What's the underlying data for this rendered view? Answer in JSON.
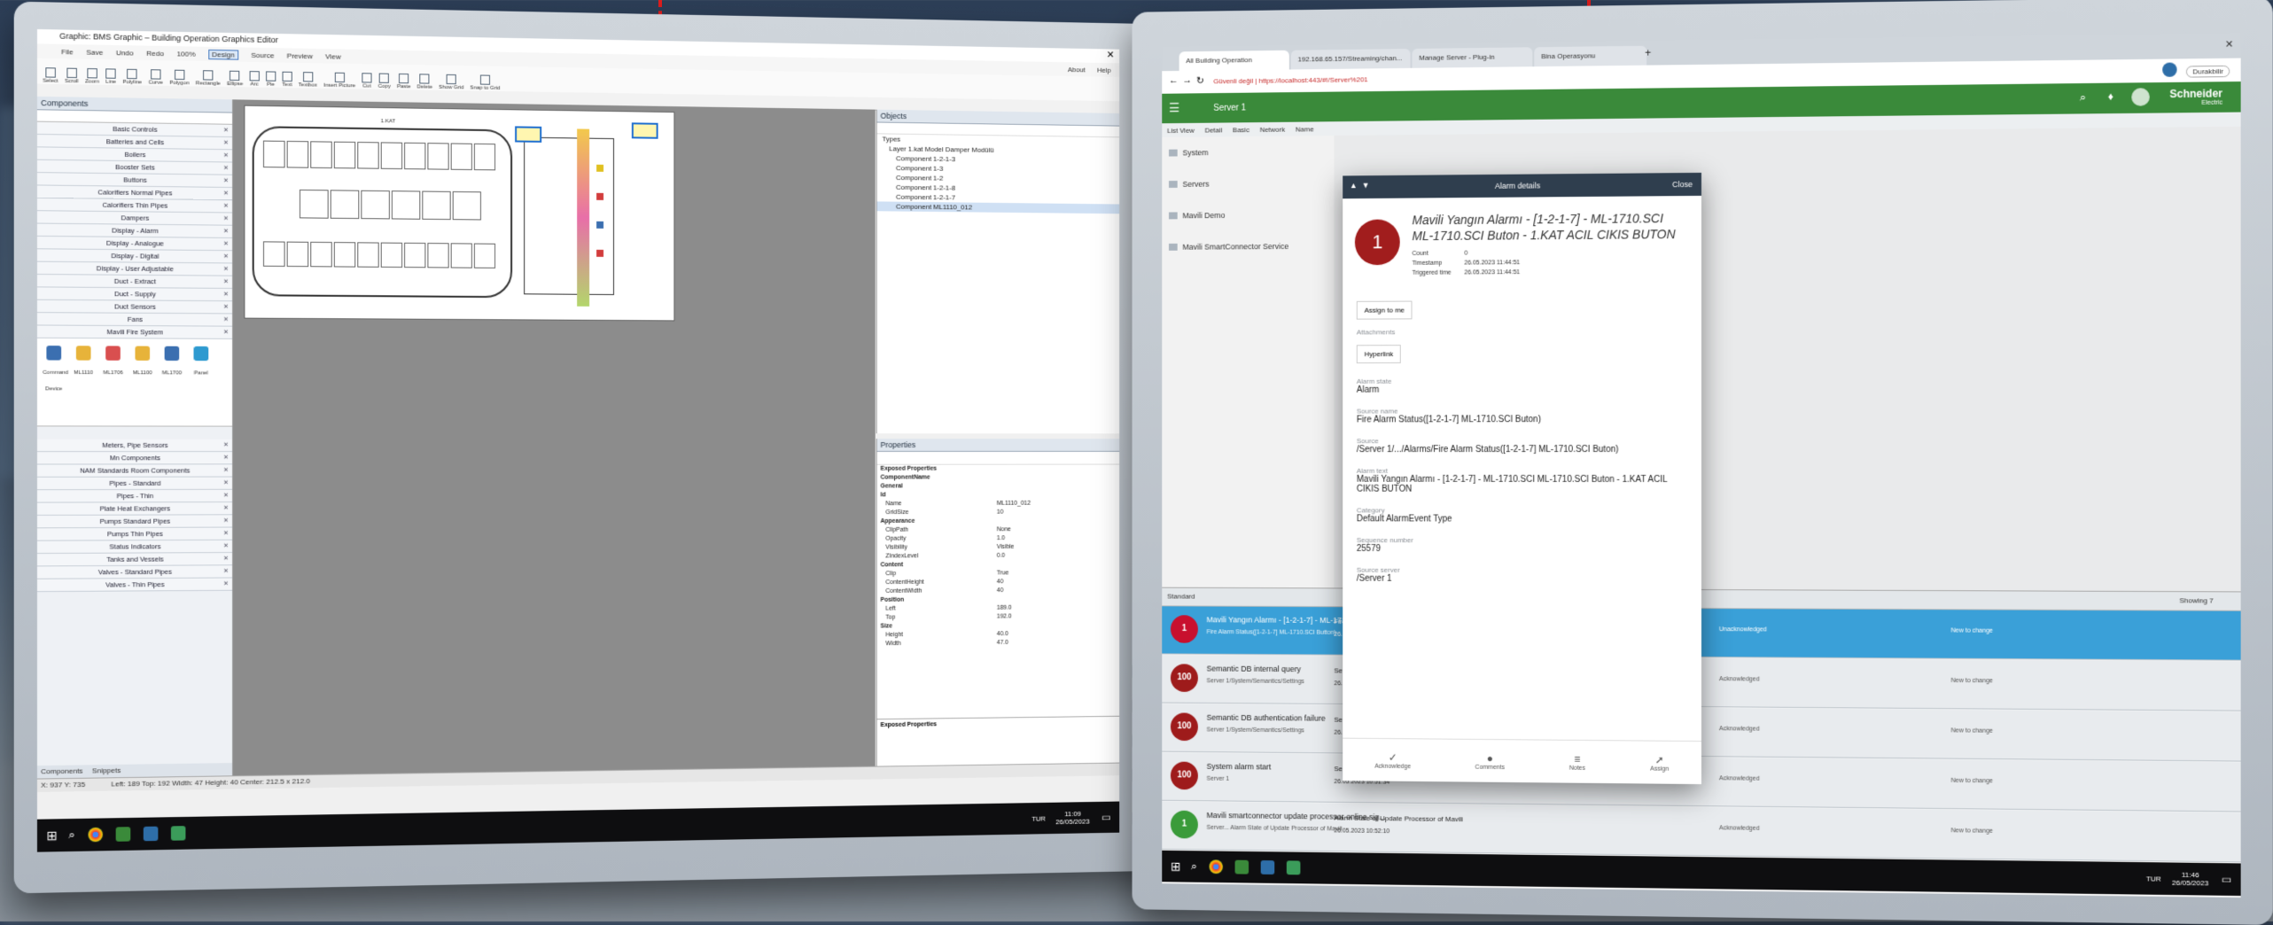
{
  "left_monitor": {
    "window_title": "Graphic: BMS Graphic – Building Operation Graphics Editor",
    "menu": [
      "File",
      "Save",
      "Undo",
      "Redo",
      "100%",
      "Design",
      "Source",
      "Preview",
      "View"
    ],
    "toolbar": [
      "Select",
      "Scroll",
      "Zoom",
      "Line",
      "Polyline",
      "Curve",
      "Polygon",
      "Rectangle",
      "Ellipse",
      "Arc",
      "Pie",
      "Text",
      "Textbox",
      "Insert Picture",
      "Cut",
      "Copy",
      "Paste",
      "Delete",
      "Show Grid",
      "Snap to Grid"
    ],
    "about_label": "About",
    "help_label": "Help",
    "components_title": "Components",
    "components": [
      "Basic Controls",
      "Batteries and Cells",
      "Boilers",
      "Booster Sets",
      "Buttons",
      "Calorifiers Normal Pipes",
      "Calorifiers Thin Pipes",
      "Dampers",
      "Display - Alarm",
      "Display - Analogue",
      "Display - Digital",
      "Display - User Adjustable",
      "Duct - Extract",
      "Duct - Supply",
      "Duct Sensors",
      "Fans",
      "Mavili Fire System"
    ],
    "fire_items": [
      "Command Device",
      "ML1110",
      "ML1706",
      "ML1100",
      "ML1700",
      "Panel"
    ],
    "components_lower": [
      "Meters, Pipe Sensors",
      "Mn Components",
      "NAM Standards Room Components",
      "Pipes - Standard",
      "Pipes - Thin",
      "Plate Heat Exchangers",
      "Pumps Standard Pipes",
      "Pumps Thin Pipes",
      "Status Indicators",
      "Tanks and Vessels",
      "Valves - Standard Pipes",
      "Valves - Thin Pipes"
    ],
    "bottom_tabs": [
      "Components",
      "Snippets"
    ],
    "status_text": "Left: 189  Top: 192  Width: 47  Height: 40  Center: 212.5 x 212.0",
    "zoom_text": "X: 937  Y: 735",
    "objects_title": "Objects",
    "objects_tree": [
      "Layer   1.kat Model Damper Modülü",
      "Component   1-2-1-3",
      "Component   1-3",
      "Component   1-2",
      "Component   1-2-1-8",
      "Component   1-2-1-7",
      "Component   ML1110_012"
    ],
    "objects_root": "Types",
    "properties_title": "Properties",
    "properties": [
      {
        "k": "Exposed Properties",
        "v": ""
      },
      {
        "k": "ComponentName",
        "v": ""
      },
      {
        "k": "General",
        "v": ""
      },
      {
        "k": "Id",
        "v": ""
      },
      {
        "k": "Name",
        "v": "ML1110_012"
      },
      {
        "k": "GridSize",
        "v": "10"
      },
      {
        "k": "Appearance",
        "v": ""
      },
      {
        "k": "ClipPath",
        "v": "None"
      },
      {
        "k": "Opacity",
        "v": "1.0"
      },
      {
        "k": "Visibility",
        "v": "Visible"
      },
      {
        "k": "ZIndexLevel",
        "v": "0.0"
      },
      {
        "k": "Content",
        "v": ""
      },
      {
        "k": "Clip",
        "v": "True"
      },
      {
        "k": "ContentHeight",
        "v": "40"
      },
      {
        "k": "ContentWidth",
        "v": "40"
      },
      {
        "k": "Position",
        "v": ""
      },
      {
        "k": "Left",
        "v": "189.0"
      },
      {
        "k": "Top",
        "v": "192.0"
      },
      {
        "k": "Size",
        "v": ""
      },
      {
        "k": "Height",
        "v": "40.0"
      },
      {
        "k": "Width",
        "v": "47.0"
      }
    ],
    "exposed_footer": "Exposed Properties",
    "floor_label": "1.KAT",
    "clock": "11:09",
    "date": "26/05/2023",
    "lang": "TUR"
  },
  "right_monitor": {
    "tabs": [
      "All Building Operation",
      "192.168.65.157/Streaming/chan...",
      "Manage Server - Plug-in",
      "Bina Operasyonu"
    ],
    "address": "Güvenli değil | https://localhost:443/#!/Server%201",
    "profile_label": "Durakbilir",
    "header_title": "Server 1",
    "brand": "Schneider",
    "brand_sub": "Electric",
    "view_tabs": [
      "List View",
      "Detail",
      "Basic",
      "Network",
      "Name"
    ],
    "nav_items": [
      "System",
      "Servers",
      "Mavili Demo",
      "Mavili SmartConnector Service"
    ],
    "list_filter": "Standard",
    "showing": "Showing 7",
    "alarms": [
      {
        "sev": "1",
        "title": "Mavili Yangın Alarmı - [1-2-1-7] - ML-1710.SCI",
        "sub": "Fire Alarm Status([1-2-1-7] ML-1710.SCI Button)",
        "value": "Fire Alarm Status([1-2-1-7]...",
        "time": "26.05.2023 11:44:51",
        "color": "#c8102e"
      },
      {
        "sev": "100",
        "title": "Semantic DB internal query",
        "sub": "Server 1/System/Semantics/Settings",
        "value": "Settings",
        "time": "26.05.2023 10:53:06",
        "color": "#9e1b1b"
      },
      {
        "sev": "100",
        "title": "Semantic DB authentication failure",
        "sub": "Server 1/System/Semantics/Settings",
        "value": "Settings",
        "time": "26.05.2023 10:51:52",
        "color": "#9e1b1b"
      },
      {
        "sev": "100",
        "title": "System alarm start",
        "sub": "Server 1",
        "value": "Server 1",
        "time": "26.05.2023 10:51:34",
        "color": "#9e1b1b"
      },
      {
        "sev": "1",
        "title": "Mavili smartconnector update processor online sig...",
        "sub": "Server... Alarm State of Update Processor of Mavili",
        "value": "Alarm State of Update Processor of Mavili",
        "time": "26.05.2023 10:52:10",
        "color": "#3a9b3a"
      }
    ],
    "row_side": [
      "Unacknowledged",
      "Acknowledged",
      "Acknowledged",
      "Acknowledged",
      "Acknowledged"
    ],
    "row_right": [
      "New to change",
      "New to change",
      "New to change",
      "New to change",
      "New to change"
    ],
    "detail": {
      "header": "Alarm details",
      "close": "Close",
      "badge": "1",
      "title": "Mavili Yangın Alarmı - [1-2-1-7] - ML-1710.SCI ML-1710.SCI Buton - 1.KAT ACIL CIKIS BUTON",
      "count_label": "Count",
      "count": "0",
      "timestamp_label": "Timestamp",
      "timestamp": "26.05.2023 11:44:51",
      "triggered_label": "Triggered time",
      "triggered": "26.05.2023 11:44:51",
      "assign_btn": "Assign to me",
      "attachments": "Attachments",
      "hyperlink": "Hyperlink",
      "fields": [
        {
          "label": "Alarm state",
          "value": "Alarm"
        },
        {
          "label": "Source name",
          "value": "Fire Alarm Status([1-2-1-7] ML-1710.SCI Buton)"
        },
        {
          "label": "Source",
          "value": "/Server 1/.../Alarms/Fire Alarm Status([1-2-1-7] ML-1710.SCI Buton)"
        },
        {
          "label": "Alarm text",
          "value": "Mavili Yangın Alarmı - [1-2-1-7] - ML-1710.SCI ML-1710.SCI Buton - 1.KAT ACIL CIKIS BUTON"
        },
        {
          "label": "Category",
          "value": "Default AlarmEvent Type"
        },
        {
          "label": "Sequence number",
          "value": "25579"
        },
        {
          "label": "Source server",
          "value": "/Server 1"
        }
      ],
      "actions": [
        "Acknowledge",
        "Comments",
        "Notes",
        "Assign"
      ]
    },
    "clock": "11:46",
    "date": "26/05/2023",
    "lang": "TUR"
  },
  "colors": {
    "accent_green": "#3a8a3a",
    "alarm_red": "#c8102e",
    "highlight_blue": "#3aa0d8",
    "red_line": "#e01d1d"
  }
}
